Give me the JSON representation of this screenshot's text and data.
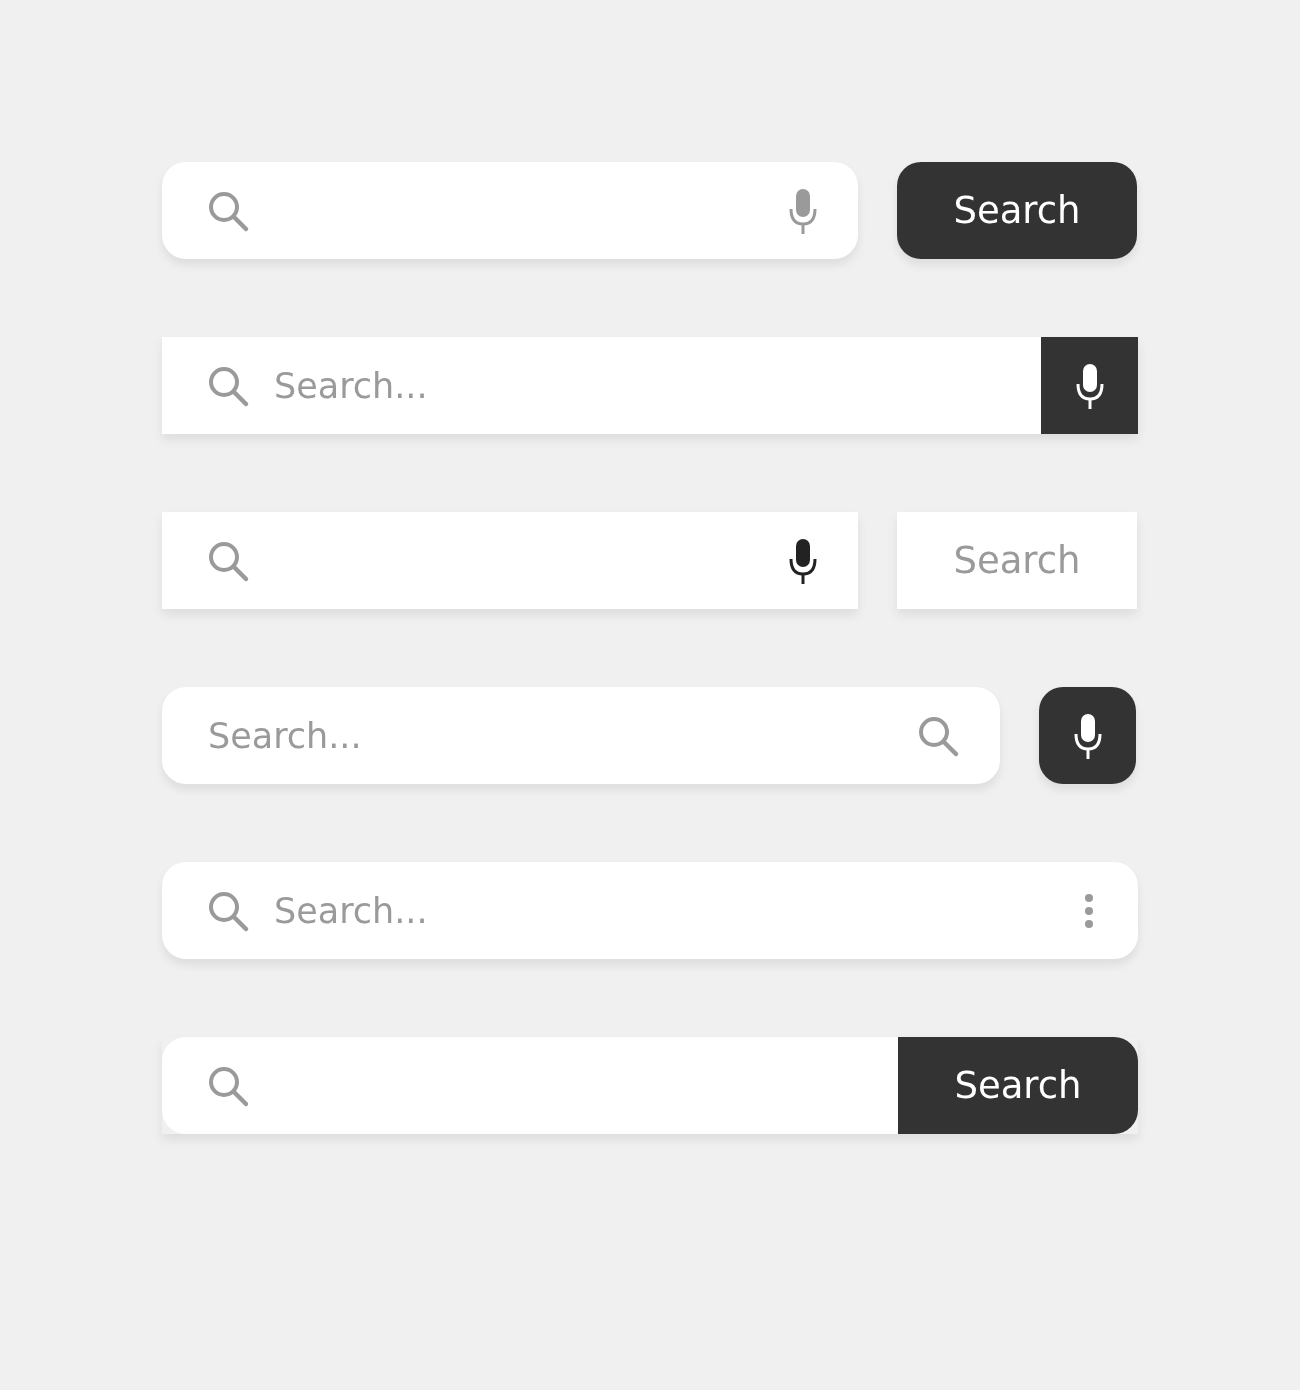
{
  "search_bars": [
    {
      "kind": "pill-button",
      "button": "Search"
    },
    {
      "kind": "square-voice",
      "placeholder": "Search..."
    },
    {
      "kind": "square-button",
      "button": "Search"
    },
    {
      "kind": "pill-voice",
      "placeholder": "Search..."
    },
    {
      "kind": "pill-menu",
      "placeholder": "Search..."
    },
    {
      "kind": "pill-attached",
      "button": "Search"
    }
  ]
}
